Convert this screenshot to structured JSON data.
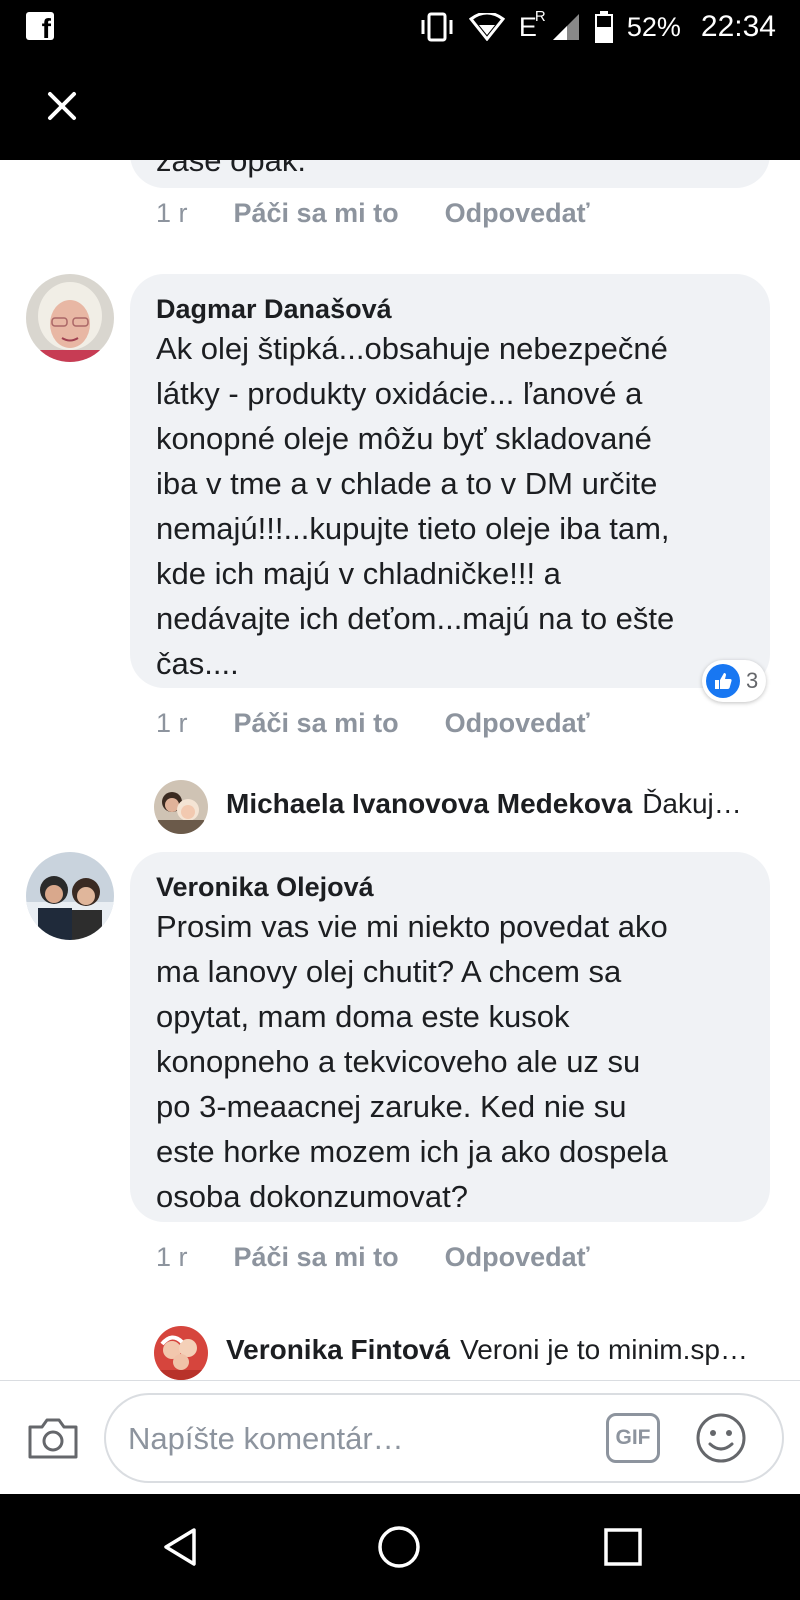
{
  "status_bar": {
    "app_icon": "facebook-icon",
    "app_letter": "f",
    "battery_percent": "52%",
    "time": "22:34",
    "network_label": "E",
    "network_roaming": "R"
  },
  "top_bar": {
    "close_icon": "close-icon"
  },
  "comments": [
    {
      "partial_text": "zase opak.",
      "time": "1 r",
      "like_label": "Páči sa mi to",
      "reply_label": "Odpovedať"
    },
    {
      "author": "Dagmar Današová",
      "text": "Ak olej štipká...obsahuje nebezpečné\nlátky - produkty oxidácie... ľanové a\nkonopné oleje môžu byť skladované\niba v tme a v chlade a to v DM určite\nnemajú!!!...kupujte tieto oleje iba tam,\nkde ich majú v chladničke!!! a\nnedávajte ich deťom...majú na to ešte\nčas....",
      "time": "1 r",
      "like_label": "Páči sa mi to",
      "reply_label": "Odpovedať",
      "reaction_count": "3",
      "reply_preview": {
        "name": "Michaela Ivanovova Medekova",
        "text": "Ďakuj…"
      }
    },
    {
      "author": "Veronika Olejová",
      "text": "Prosim vas vie mi niekto povedat ako\nma lanovy olej chutit? A chcem sa\nopytat, mam doma este kusok\nkonopneho a tekvicoveho ale uz su\npo 3-meaacnej zaruke. Ked nie su\neste horke mozem ich ja ako dospela\nosoba dokonzumovat?",
      "time": "1 r",
      "like_label": "Páči sa mi to",
      "reply_label": "Odpovedať",
      "reply_preview": {
        "name": "Veronika Fintová",
        "text": "Veroni je to minim.sp…"
      }
    }
  ],
  "composer": {
    "placeholder": "Napíšte komentár…",
    "gif_label": "GIF"
  },
  "colors": {
    "bubble": "#f0f2f5",
    "meta": "#8d949e",
    "like_blue": "#1877f2"
  }
}
